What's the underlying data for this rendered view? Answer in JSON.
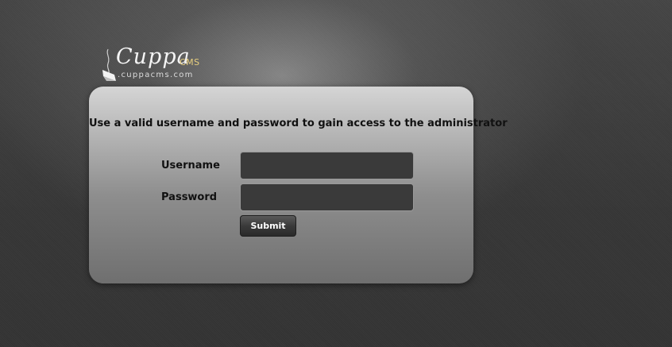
{
  "logo": {
    "wordmark": "Cuppa",
    "suffix": "CMS",
    "url": ".cuppacms.com",
    "icon": "steaming-cup-icon",
    "suffix_color": "#e8cf7e"
  },
  "login": {
    "message": "Use a valid username and password to gain access to the administrator",
    "username_label": "Username",
    "username_value": "",
    "password_label": "Password",
    "password_value": "",
    "submit_label": "Submit"
  },
  "colors": {
    "background": "#3a3a3a",
    "panel_top": "#d5d5d5",
    "panel_bottom": "#6f6f6f",
    "input_background": "#3a3a3a"
  }
}
